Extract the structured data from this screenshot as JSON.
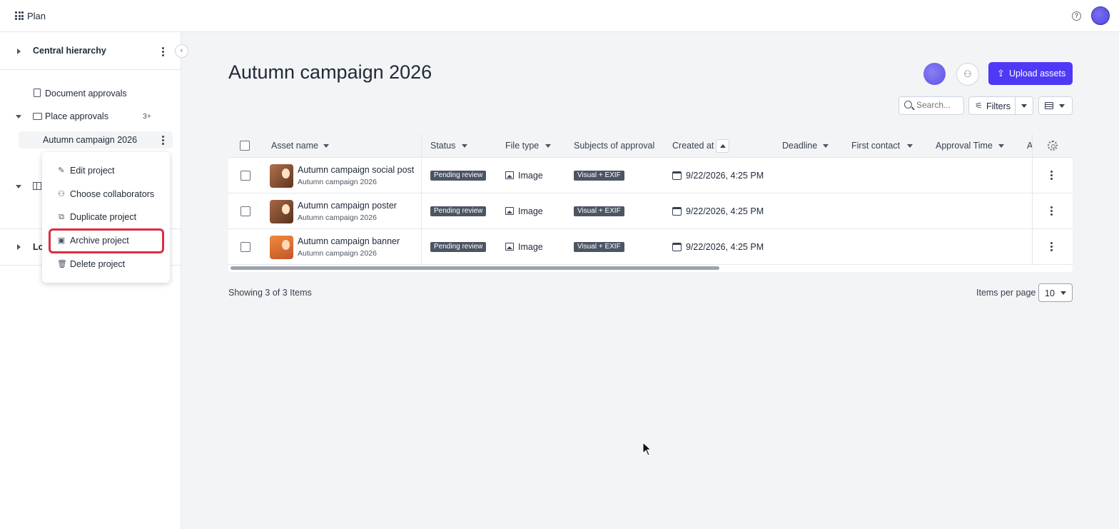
{
  "topbar": {
    "app_name": "Plan",
    "help_glyph": "?"
  },
  "sidebar": {
    "hierarchy_title": "Central hierarchy",
    "items": [
      {
        "label": "Document approvals",
        "icon": "document-icon"
      },
      {
        "label": "Place approvals",
        "icon": "folder-open-icon",
        "count": "3+"
      },
      {
        "label": "Autumn campaign 2026",
        "selected": true
      }
    ],
    "truncated_section_label": "Lo",
    "collapse_glyph": "‹"
  },
  "context_menu": {
    "items": [
      {
        "label": "Edit project",
        "icon": "pencil-icon",
        "glyph": "✎"
      },
      {
        "label": "Choose collaborators",
        "icon": "user-plus-icon",
        "glyph": "⚇"
      },
      {
        "label": "Duplicate project",
        "icon": "duplicate-icon",
        "glyph": "⧉"
      },
      {
        "label": "Archive project",
        "icon": "archive-icon",
        "glyph": "▣",
        "highlighted": true
      },
      {
        "label": "Delete project",
        "icon": "trash-icon",
        "glyph": "🗑"
      }
    ]
  },
  "main": {
    "title": "Autumn campaign 2026",
    "upload_label": "Upload assets",
    "upload_glyph": "⇪",
    "add_person_glyph": "⚇",
    "search_placeholder": "Search...",
    "filters_label": "Filters",
    "filters_glyph": "⚟"
  },
  "table": {
    "columns": [
      "Asset name",
      "Status",
      "File type",
      "Subjects of approval",
      "Created at",
      "Deadline",
      "First contact",
      "Approval Time",
      "A"
    ],
    "rows": [
      {
        "name": "Autumn campaign social post",
        "project": "Autumn campaign 2026",
        "status": "Pending review",
        "file_type": "Image",
        "subjects": "Visual + EXIF",
        "created_at": "9/22/2026, 4:25 PM",
        "thumb_colors": [
          "#b2714a",
          "#5e3522"
        ]
      },
      {
        "name": "Autumn campaign poster",
        "project": "Autumn campaign 2026",
        "status": "Pending review",
        "file_type": "Image",
        "subjects": "Visual + EXIF",
        "created_at": "9/22/2026, 4:25 PM",
        "thumb_colors": [
          "#a86845",
          "#58311f"
        ]
      },
      {
        "name": "Autumn campaign banner",
        "project": "Autumn campaign 2026",
        "status": "Pending review",
        "file_type": "Image",
        "subjects": "Visual + EXIF",
        "created_at": "9/22/2026, 4:25 PM",
        "thumb_colors": [
          "#f08a3c",
          "#c2562a"
        ]
      }
    ]
  },
  "footer": {
    "showing": "Showing 3 of 3 Items",
    "items_per_page_label": "Items per page",
    "items_per_page_value": "10"
  },
  "colors": {
    "accent": "#4f39f6",
    "highlight_border": "#dc2e43",
    "badge_bg": "#4b5563"
  }
}
